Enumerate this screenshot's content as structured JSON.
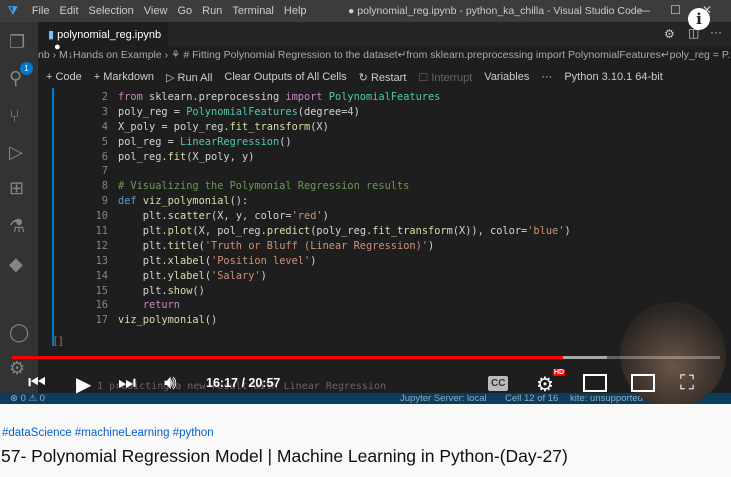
{
  "titlebar": {
    "menu": [
      "File",
      "Edit",
      "Selection",
      "View",
      "Go",
      "Run",
      "Terminal",
      "Help"
    ],
    "title": "● polynomial_reg.ipynb - python_ka_chilla - Visual Studio Code"
  },
  "explorer_badge": "1",
  "tab": {
    "label": "polynomial_reg.ipynb",
    "dirty": "●"
  },
  "breadcrumb": "nb › M↓Hands on Example › ⚘ # Fitting Polynomial Regression to the dataset↵from sklearn.preprocessing import PolynomialFeatures↵poly_reg = P...",
  "toolbar": {
    "code": "+ Code",
    "markdown": "+ Markdown",
    "run_all": "▷ Run All",
    "clear": "Clear Outputs of All Cells",
    "restart": "↻ Restart",
    "interrupt": "☐ Interrupt",
    "variables": "Variables",
    "more": "···",
    "kernel": "Python 3.10.1 64-bit"
  },
  "code_lines": [
    {
      "n": "2",
      "t": [
        [
          "from ",
          "pp"
        ],
        [
          "sklearn.preprocessing ",
          ""
        ],
        [
          "import ",
          "pp"
        ],
        [
          "PolynomialFeatures",
          "cl"
        ]
      ]
    },
    {
      "n": "3",
      "t": [
        [
          "poly_reg = ",
          ""
        ],
        [
          "PolynomialFeatures",
          "cl"
        ],
        [
          "(degree=",
          ""
        ],
        [
          "4",
          "nm"
        ],
        [
          ")",
          ""
        ]
      ]
    },
    {
      "n": "4",
      "t": [
        [
          "X_poly = poly_reg.",
          ""
        ],
        [
          "fit_transform",
          "fn"
        ],
        [
          "(X)",
          ""
        ]
      ]
    },
    {
      "n": "5",
      "t": [
        [
          "pol_reg = ",
          ""
        ],
        [
          "LinearRegression",
          "cl"
        ],
        [
          "()",
          ""
        ]
      ]
    },
    {
      "n": "6",
      "t": [
        [
          "pol_reg.",
          ""
        ],
        [
          "fit",
          "fn"
        ],
        [
          "(X_poly, y)",
          ""
        ]
      ]
    },
    {
      "n": "7",
      "t": []
    },
    {
      "n": "8",
      "t": [
        [
          "# Visualizing the Polymonial Regression results",
          "cm"
        ]
      ]
    },
    {
      "n": "9",
      "t": [
        [
          "def ",
          "kw"
        ],
        [
          "viz_polymonial",
          "fn"
        ],
        [
          "():",
          ""
        ]
      ]
    },
    {
      "n": "10",
      "t": [
        [
          "    plt.",
          ""
        ],
        [
          "scatter",
          "fn"
        ],
        [
          "(X, y, color=",
          ""
        ],
        [
          "'red'",
          "st"
        ],
        [
          ")",
          ""
        ]
      ]
    },
    {
      "n": "11",
      "t": [
        [
          "    plt.",
          ""
        ],
        [
          "plot",
          "fn"
        ],
        [
          "(X, pol_reg.",
          ""
        ],
        [
          "predict",
          "fn"
        ],
        [
          "(poly_reg.",
          ""
        ],
        [
          "fit_transform",
          "fn"
        ],
        [
          "(X)), color=",
          ""
        ],
        [
          "'blue'",
          "st"
        ],
        [
          ")",
          ""
        ]
      ]
    },
    {
      "n": "12",
      "t": [
        [
          "    plt.",
          ""
        ],
        [
          "title",
          "fn"
        ],
        [
          "(",
          ""
        ],
        [
          "'Truth or Bluff (Linear Regression)'",
          "st"
        ],
        [
          ")",
          ""
        ]
      ]
    },
    {
      "n": "13",
      "t": [
        [
          "    plt.",
          ""
        ],
        [
          "xlabel",
          "fn"
        ],
        [
          "(",
          ""
        ],
        [
          "'Position level'",
          "st"
        ],
        [
          ")",
          ""
        ]
      ]
    },
    {
      "n": "14",
      "t": [
        [
          "    plt.",
          ""
        ],
        [
          "ylabel",
          "fn"
        ],
        [
          "(",
          ""
        ],
        [
          "'Salary'",
          "st"
        ],
        [
          ")",
          ""
        ]
      ]
    },
    {
      "n": "15",
      "t": [
        [
          "    plt.",
          ""
        ],
        [
          "show",
          "fn"
        ],
        [
          "()",
          ""
        ]
      ]
    },
    {
      "n": "16",
      "t": [
        [
          "    ",
          ""
        ],
        [
          "return",
          "pp"
        ]
      ]
    },
    {
      "n": "17",
      "t": [
        [
          "viz_polymonial",
          "fn"
        ],
        [
          "()",
          ""
        ]
      ]
    }
  ],
  "cell_marker": "[ ]",
  "next_cell": "1   predicting a new result with Linear Regression",
  "statusbar": {
    "problems": "⊗ 0 ⚠ 0",
    "server": "Jupyter Server: local",
    "cell": "Cell 12 of 16",
    "kite": "kite: unsupported"
  },
  "player": {
    "time": "16:17 / 20:57",
    "played_fraction": 0.778,
    "buffered_fraction": 0.84,
    "hd": "HD",
    "cc": "CC",
    "progress_color": "#ff0000"
  },
  "video_info": {
    "hashtags": "#dataScience #machineLearning #python",
    "title": "57- Polynomial Regression Model | Machine Learning in Python-(Day-27)"
  }
}
